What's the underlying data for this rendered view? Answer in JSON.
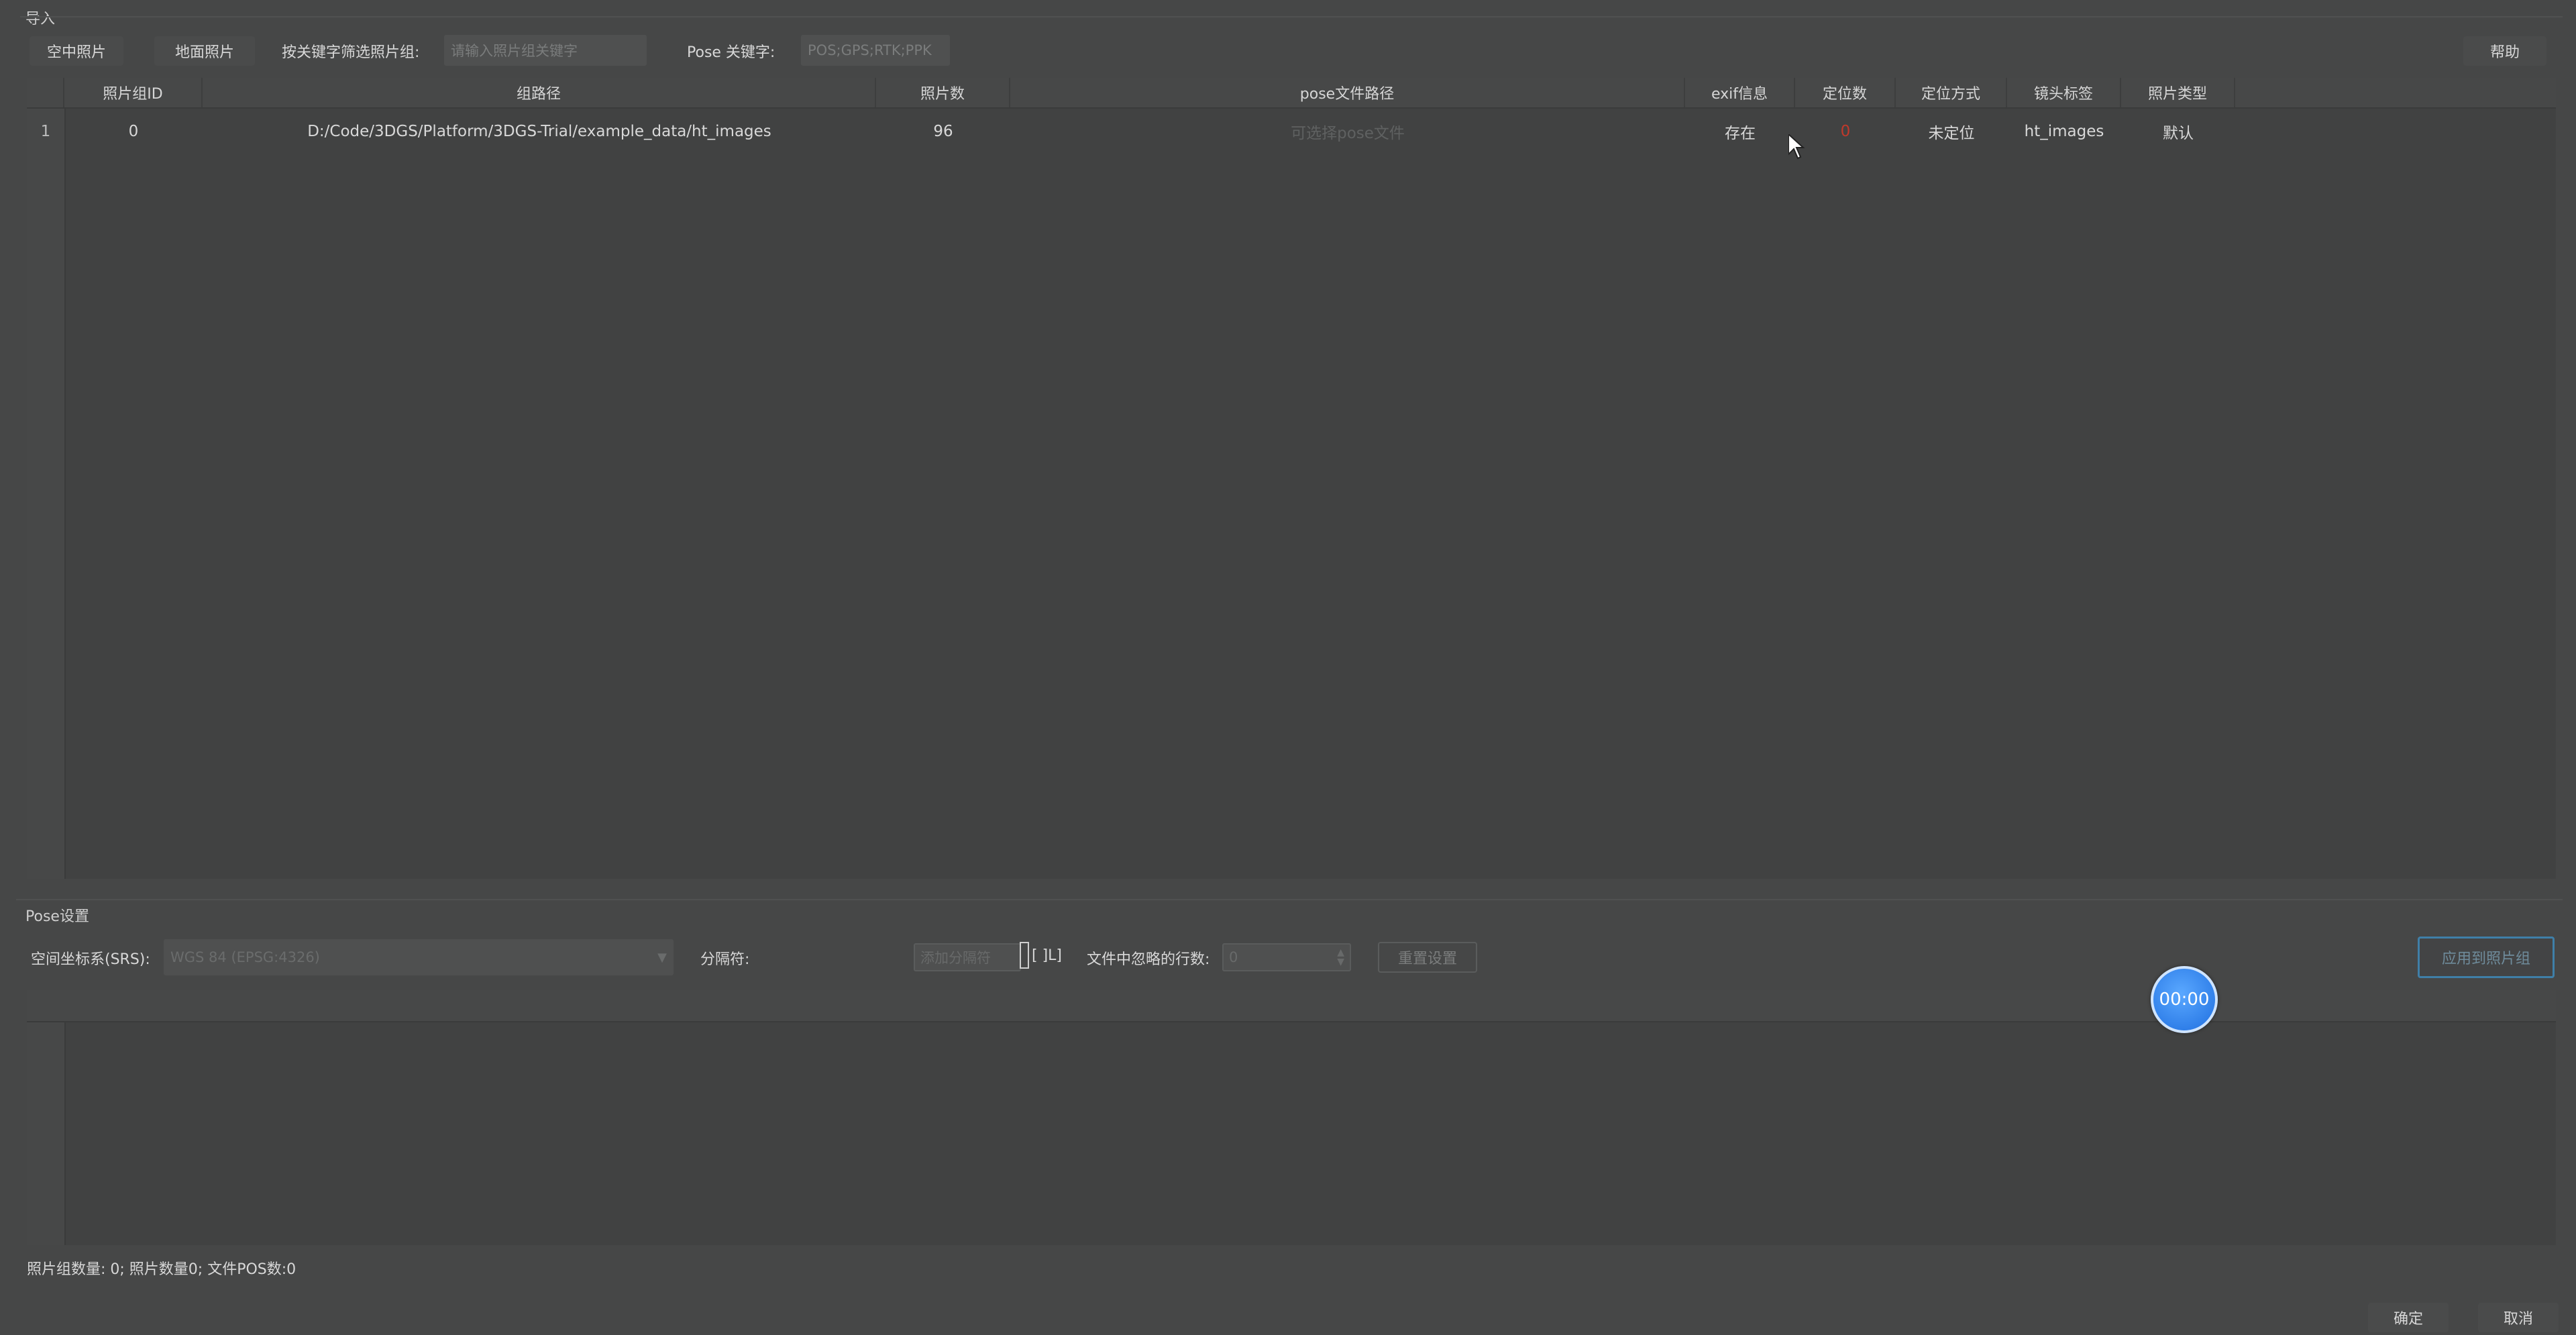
{
  "import_group": {
    "title": "导入",
    "tabs": [
      {
        "label": "空中照片"
      },
      {
        "label": "地面照片"
      }
    ],
    "filter_label": "按关键字筛选照片组:",
    "filter_placeholder": "请输入照片组关键字",
    "pose_keyword_label": "Pose 关键字:",
    "pose_keyword_placeholder": "POS;GPS;RTK;PPK",
    "help_label": "帮助"
  },
  "table": {
    "columns": [
      "照片组ID",
      "组路径",
      "照片数",
      "pose文件路径",
      "exif信息",
      "定位数",
      "定位方式",
      "镜头标签",
      "照片类型"
    ],
    "rows": [
      {
        "row_number": "1",
        "id": "0",
        "path": "D:/Code/3DGS/Platform/3DGS-Trial/example_data/ht_images",
        "count": "96",
        "pose_path": "可选择pose文件",
        "exif": "存在",
        "loc_count": "0",
        "loc_method": "未定位",
        "lens_tag": "ht_images",
        "photo_type": "默认"
      }
    ]
  },
  "pose_group": {
    "title": "Pose设置",
    "srs_label": "空间坐标系(SRS):",
    "srs_value": "WGS 84 (EPSG:4326)",
    "delimiter_label": "分隔符:",
    "delimiter_placeholder": "添加分隔符",
    "delimiter_bracket": "[ ]L]",
    "ignore_rows_label": "文件中忽略的行数:",
    "ignore_rows_value": "0",
    "reset_label": "重置设置",
    "apply_label": "应用到照片组"
  },
  "status_text": "照片组数量:  0;  照片数量0;  文件POS数:0",
  "timer_text": "00:00",
  "footer": {
    "ok_label": "确定",
    "cancel_label": "取消"
  },
  "colors": {
    "background": "#464747",
    "panel": "#414242",
    "accent_red": "#c0392b",
    "timer_blue": "#2f86f0"
  }
}
